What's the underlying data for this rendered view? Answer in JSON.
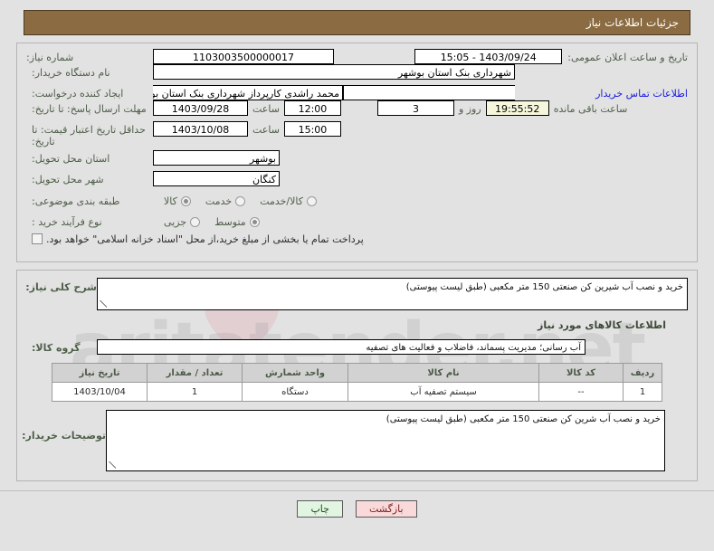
{
  "header": {
    "title": "جزئیات اطلاعات نیاز"
  },
  "announce": {
    "label": "تاریخ و ساعت اعلان عمومی:",
    "value": "1403/09/24 - 15:05"
  },
  "contact_link": {
    "label": "اطلاعات تماس خریدار"
  },
  "form": {
    "need_number": {
      "label": "شماره نیاز:",
      "value": "1103003500000017"
    },
    "buyer_org": {
      "label": "نام دستگاه خریدار:",
      "value": "شهرداری بنک استان بوشهر"
    },
    "requester": {
      "label": "ایجاد کننده درخواست:",
      "value": "محمد  راشدی کارپرداز شهرداری بنک استان بوشهر"
    },
    "response_deadline": {
      "label": "مهلت ارسال پاسخ: تا تاریخ:",
      "date": "1403/09/28",
      "time_label": "ساعت",
      "time": "12:00",
      "days": "3",
      "days_suffix": "روز و",
      "countdown": "19:55:52",
      "countdown_suffix": "ساعت باقی مانده"
    },
    "price_validity": {
      "label": "حداقل تاریخ اعتبار قیمت: تا تاریخ:",
      "date": "1403/10/08",
      "time_label": "ساعت",
      "time": "15:00"
    },
    "province": {
      "label": "استان محل تحویل:",
      "value": "بوشهر"
    },
    "city": {
      "label": "شهر محل تحویل:",
      "value": "کنگان"
    },
    "category": {
      "label": "طبقه بندی موضوعی:",
      "options": [
        "کالا",
        "خدمت",
        "کالا/خدمت"
      ],
      "selected": "کالا"
    },
    "process_type": {
      "label": "نوع فرآیند خرید :",
      "options": [
        "جزیی",
        "متوسط"
      ],
      "selected": "متوسط"
    },
    "treasury_checkbox": {
      "label": "پرداخت تمام یا بخشی از مبلغ خرید،از محل \"اسناد خزانه اسلامی\" خواهد بود.",
      "checked": false
    }
  },
  "description": {
    "label": "شرح کلی نیاز:",
    "value": "خرید و نصب آب شیرین کن صنعتی 150 متر مکعبی (طبق لیست پیوستی)"
  },
  "goods_section": {
    "heading": "اطلاعات کالاهای مورد نیاز",
    "group": {
      "label": "گروه کالا:",
      "value": "آب رسانی؛ مدیریت پسماند، فاضلاب و فعالیت های تصفیه"
    }
  },
  "items_table": {
    "columns": [
      "ردیف",
      "کد کالا",
      "نام کالا",
      "واحد شمارش",
      "تعداد / مقدار",
      "تاریخ نیاز"
    ],
    "rows": [
      {
        "radif": "1",
        "code": "--",
        "name": "سیستم تصفیه آب",
        "unit": "دستگاه",
        "qty": "1",
        "date": "1403/10/04"
      }
    ]
  },
  "buyer_notes": {
    "label": "توضیحات خریدار:",
    "value": "خرید و نصب آب شرین کن صنعتی 150 متر مکعبی (طبق لیست پیوستی)"
  },
  "footer": {
    "print_label": "چاپ",
    "back_label": "بازگشت"
  },
  "watermark": {
    "text": "aritatender.net"
  },
  "colors": {
    "header_bg": "#8b6b41",
    "label_text": "#4e5f49",
    "link": "#1a1ae0",
    "page_bg": "#e2e2e2",
    "table_header_bg": "#d2d2d2",
    "print_btn_bg": "#e2f5e2",
    "back_btn_bg": "#f9d9d9",
    "countdown_bg": "#f6f6dc"
  }
}
